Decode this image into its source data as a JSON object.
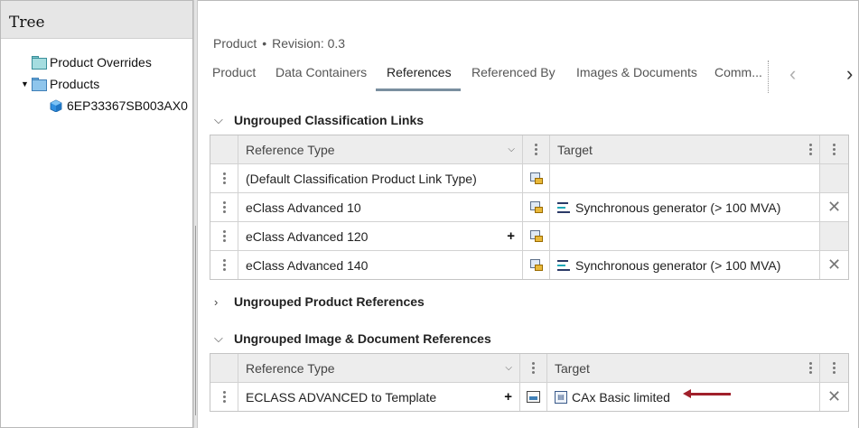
{
  "tree": {
    "title": "Tree",
    "items": [
      {
        "label": "Product Overrides",
        "icon": "folder-icon",
        "expanded": null
      },
      {
        "label": "Products",
        "icon": "folder-icon",
        "expanded": true
      },
      {
        "label": "6EP33367SB003AX0",
        "icon": "cube-icon",
        "expanded": null
      }
    ]
  },
  "header": {
    "breadcrumb_type": "Product",
    "breadcrumb_sep": "•",
    "revision": "Revision: 0.3"
  },
  "tabs": [
    {
      "label": "Product",
      "active": false
    },
    {
      "label": "Data Containers",
      "active": false
    },
    {
      "label": "References",
      "active": true
    },
    {
      "label": "Referenced By",
      "active": false
    },
    {
      "label": "Images & Documents",
      "active": false
    },
    {
      "label": "Comm...",
      "active": false
    }
  ],
  "sections": {
    "classification": {
      "title": "Ungrouped Classification Links",
      "col_reference_type": "Reference Type",
      "col_target": "Target",
      "rows": [
        {
          "type": "(Default Classification Product Link Type)",
          "target": "",
          "plus": ""
        },
        {
          "type": "eClass Advanced 10",
          "target": "Synchronous generator (> 100 MVA)",
          "plus": ""
        },
        {
          "type": "eClass Advanced 120",
          "target": "",
          "plus": "+"
        },
        {
          "type": "eClass Advanced 140",
          "target": "Synchronous generator (> 100 MVA)",
          "plus": ""
        }
      ]
    },
    "product_refs": {
      "title": "Ungrouped Product References"
    },
    "image_doc": {
      "title": "Ungrouped Image & Document References",
      "col_reference_type": "Reference Type",
      "col_target": "Target",
      "rows": [
        {
          "type": "ECLASS ADVANCED to Template",
          "target": "CAx Basic limited",
          "plus": "+"
        }
      ]
    }
  },
  "colors": {
    "annotation_arrow": "#a0202a",
    "tab_underline": "#7a8fa0"
  }
}
